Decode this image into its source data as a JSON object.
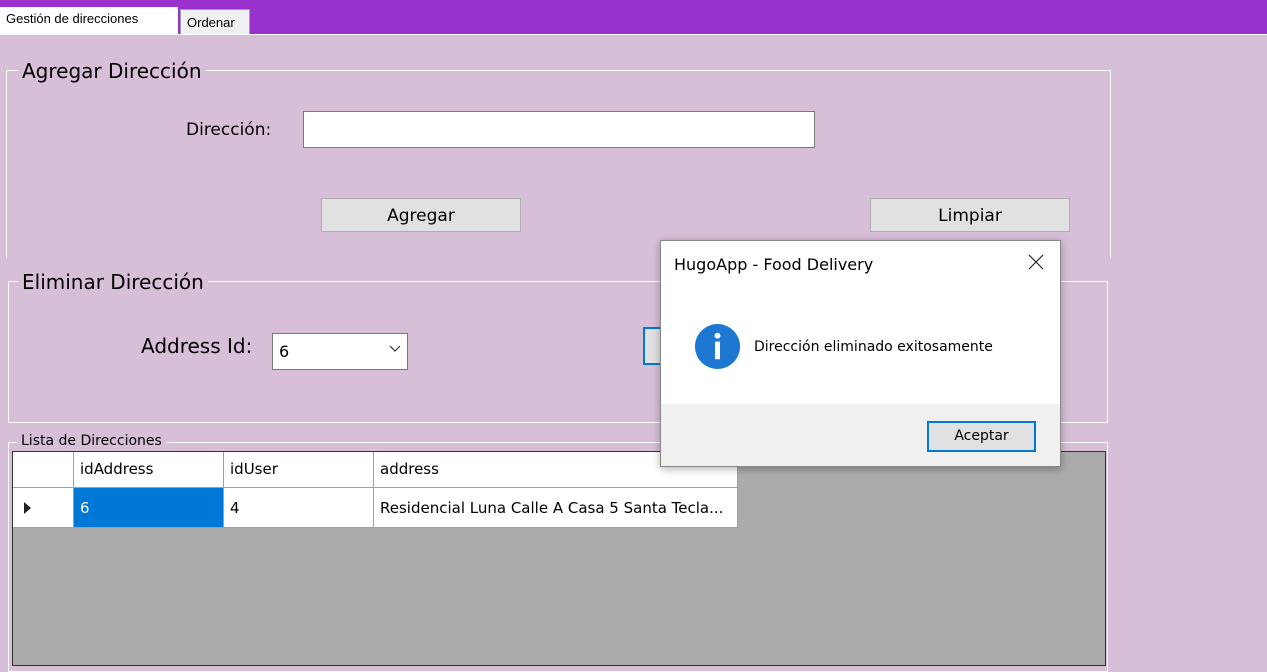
{
  "tabs": [
    {
      "label": "Gestión de direcciones",
      "active": true
    },
    {
      "label": "Ordenar",
      "active": false
    }
  ],
  "add_group": {
    "title": "Agregar Dirección",
    "address_label": "Dirección:",
    "address_value": "",
    "add_button": "Agregar",
    "clear_button": "Limpiar"
  },
  "delete_group": {
    "title": "Eliminar Dirección",
    "id_label": "Address Id:",
    "id_value": "6"
  },
  "list_group": {
    "title": "Lista de Direcciones",
    "columns": [
      "idAddress",
      "idUser",
      "address"
    ],
    "rows": [
      {
        "idAddress": "6",
        "idUser": "4",
        "address": "Residencial Luna Calle A Casa 5 Santa Tecla..."
      }
    ]
  },
  "dialog": {
    "title": "HugoApp - Food Delivery",
    "message": "Dirección eliminado exitosamente",
    "ok_button": "Aceptar",
    "icon": "info-icon"
  },
  "colors": {
    "tab_strip": "#9932cc",
    "background": "#d8bfd8",
    "selection": "#0078d7",
    "grid_background": "#ababab"
  }
}
